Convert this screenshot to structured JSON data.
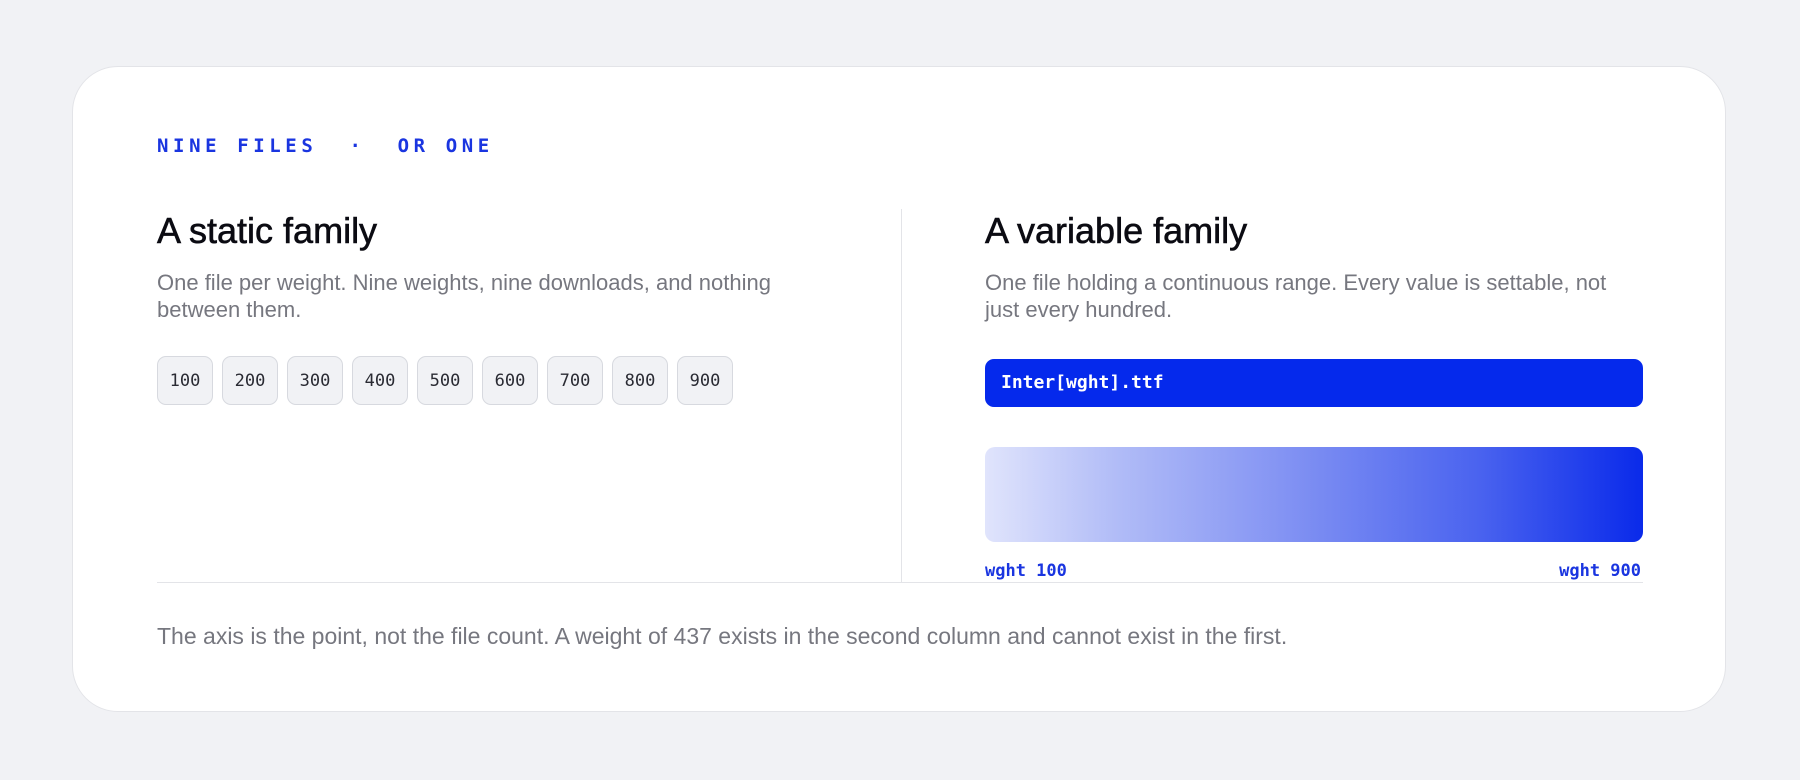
{
  "eyebrow": "NINE FILES  ·  OR ONE",
  "static": {
    "title": "A static family",
    "description": "One file per weight. Nine weights, nine downloads, and nothing between them.",
    "weights": [
      "100",
      "200",
      "300",
      "400",
      "500",
      "600",
      "700",
      "800",
      "900"
    ]
  },
  "variable": {
    "title": "A variable family",
    "description": "One file holding a continuous range. Every value is settable, not just every hundred.",
    "file_name": "Inter[wght].ttf",
    "axis_min_label": "wght 100",
    "axis_max_label": "wght 900"
  },
  "footnote": "The axis is the point, not the file count. A weight of 437 exists in the second column and cannot exist in the first.",
  "colors": {
    "accent": "#0529ec",
    "page_background": "#f1f2f5",
    "card_background": "#ffffff",
    "muted_text": "#76777f"
  }
}
